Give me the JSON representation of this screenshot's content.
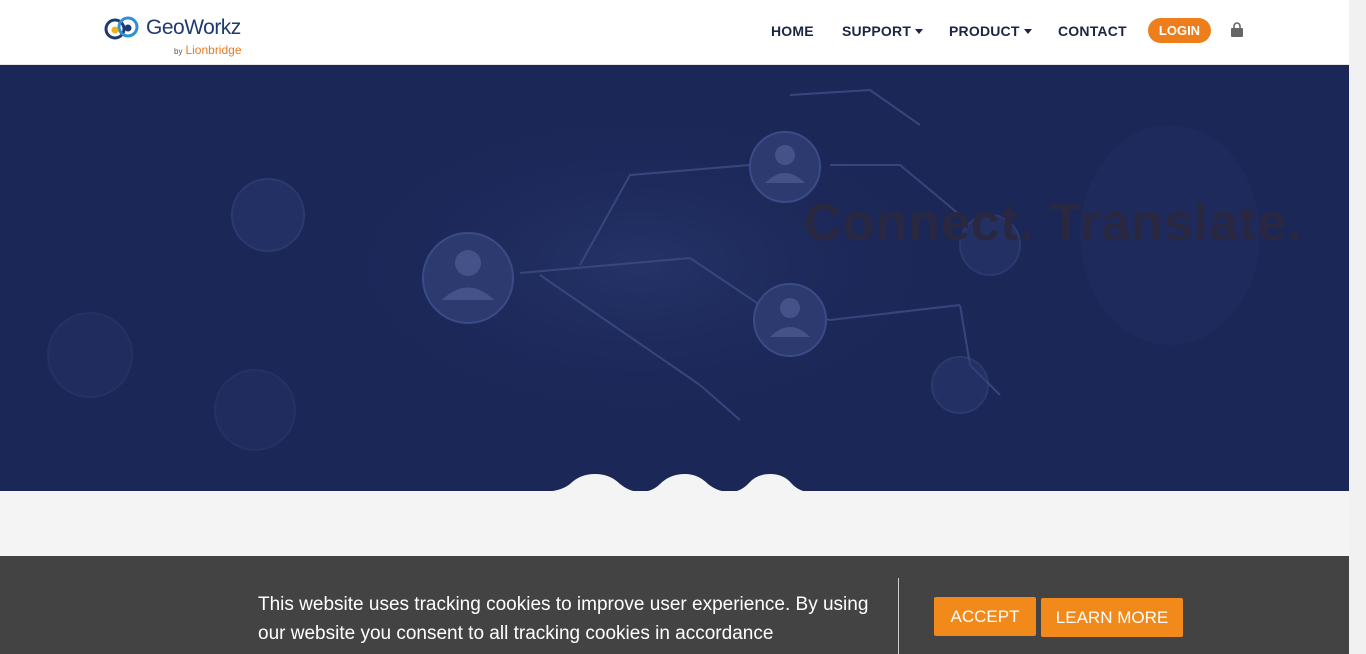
{
  "brand": {
    "name": "GeoWorkz",
    "by": "by",
    "parent": "Lionbridge"
  },
  "nav": {
    "home": "HOME",
    "support": "SUPPORT",
    "product": "PRODUCT",
    "contact": "CONTACT",
    "login": "LOGIN",
    "cart_icon": "shopping-bag-icon"
  },
  "hero": {
    "headline": "Connect. Translate."
  },
  "cookie_banner": {
    "message": "This website uses tracking cookies to improve user experience. By using our website you consent to all tracking cookies in accordance",
    "accept_label": "ACCEPT",
    "learn_more_label": "LEARN MORE"
  },
  "colors": {
    "accent": "#ee7d1b",
    "hero_bg": "#1b2757",
    "nav_text": "#1b2544",
    "cookie_bg": "#434343"
  }
}
